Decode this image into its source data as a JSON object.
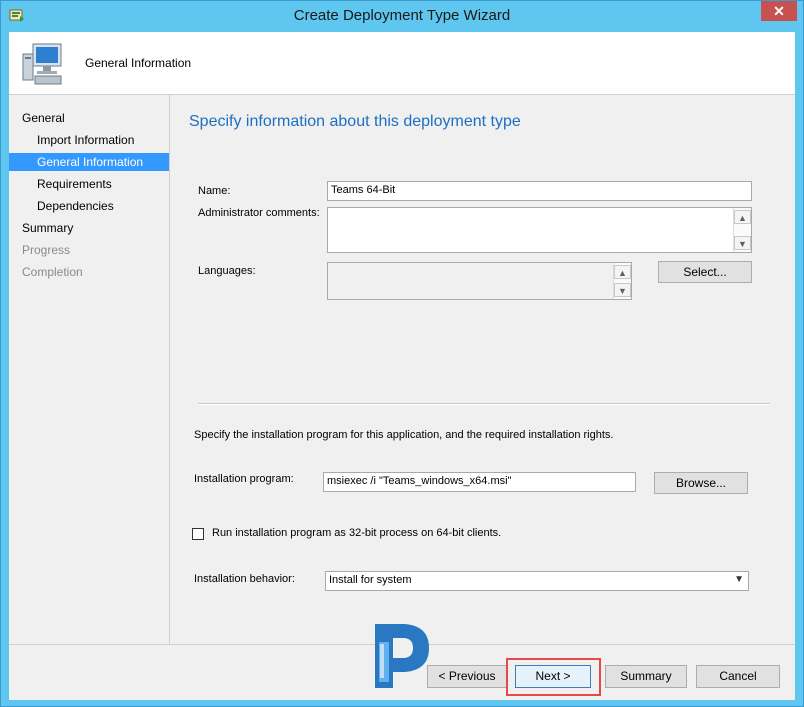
{
  "window": {
    "title": "Create Deployment Type Wizard",
    "close_label": "✕"
  },
  "header": {
    "title": "General Information",
    "icon": "computer-icon"
  },
  "nav": {
    "items": [
      {
        "label": "General",
        "level": 1,
        "state": "normal"
      },
      {
        "label": "Import Information",
        "level": 2,
        "state": "normal"
      },
      {
        "label": "General Information",
        "level": 2,
        "state": "selected"
      },
      {
        "label": "Requirements",
        "level": 2,
        "state": "normal"
      },
      {
        "label": "Dependencies",
        "level": 2,
        "state": "normal"
      },
      {
        "label": "Summary",
        "level": 1,
        "state": "normal"
      },
      {
        "label": "Progress",
        "level": 1,
        "state": "disabled"
      },
      {
        "label": "Completion",
        "level": 1,
        "state": "disabled"
      }
    ]
  },
  "main": {
    "heading": "Specify information about this deployment type",
    "name_label": "Name:",
    "name_value": "Teams 64-Bit",
    "admin_comments_label": "Administrator comments:",
    "admin_comments_value": "",
    "languages_label": "Languages:",
    "languages_value": "",
    "select_button": "Select...",
    "install_section_text": "Specify the installation program for this application, and the required installation rights.",
    "install_program_label": "Installation program:",
    "install_program_value": "msiexec /i \"Teams_windows_x64.msi\"",
    "browse_button": "Browse...",
    "run_32bit_label": "Run installation program as 32-bit process on 64-bit clients.",
    "run_32bit_checked": false,
    "install_behavior_label": "Installation behavior:",
    "install_behavior_value": "Install for system"
  },
  "footer": {
    "previous_button": "< Previous",
    "next_button": "Next >",
    "summary_button": "Summary",
    "cancel_button": "Cancel"
  },
  "colors": {
    "titlebar": "#5fc6ef",
    "selection": "#3399ff",
    "heading": "#1e6ec1",
    "highlight": "#e8484a",
    "close": "#c75050"
  }
}
